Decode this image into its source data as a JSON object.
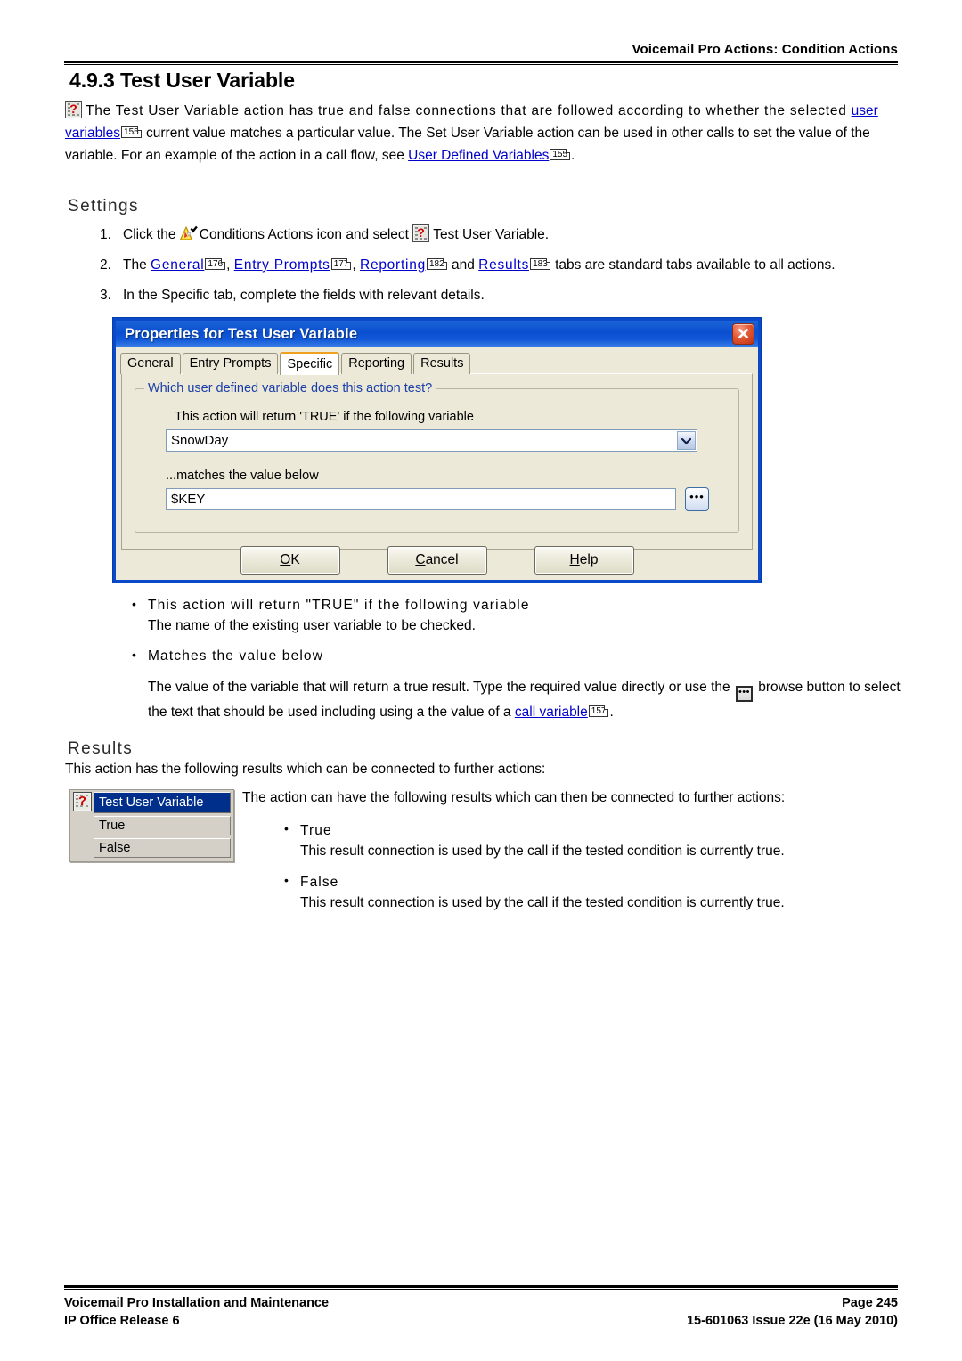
{
  "header": {
    "title": "Voicemail Pro Actions: Condition Actions"
  },
  "section": {
    "heading": "4.9.3 Test User Variable",
    "intro": {
      "part1": "The Test User Variable action has true and false connections that are followed according to whether the selected ",
      "link1": "user variables",
      "ref1": "155",
      "part2": " current value matches a particular value. The Set User Variable action can be used in other calls to set the value of the variable. For an example of the action in a call flow, see ",
      "link2": "User Defined Variables",
      "ref2": "155",
      "part3": "."
    }
  },
  "settings": {
    "heading": "Settings",
    "steps": [
      {
        "num": "1.",
        "pre": "Click the ",
        "mid": "Conditions Actions icon and select ",
        "post": "Test User Variable."
      },
      {
        "num": "2.",
        "pre": "The ",
        "links": [
          {
            "label": "General",
            "ref": "176",
            "sep": ", "
          },
          {
            "label": "Entry Prompts",
            "ref": "177",
            "sep": ", "
          },
          {
            "label": "Reporting",
            "ref": "182",
            "sep": " and "
          },
          {
            "label": "Results",
            "ref": "183",
            "sep": ""
          }
        ],
        "post": " tabs are standard tabs available to all actions."
      },
      {
        "num": "3.",
        "text": "In the Specific tab, complete the fields with relevant details."
      }
    ]
  },
  "dialog": {
    "title": "Properties for Test User Variable",
    "close_icon": "close-icon",
    "tabs": [
      {
        "label": "General",
        "active": false
      },
      {
        "label": "Entry Prompts",
        "active": false
      },
      {
        "label": "Specific",
        "active": true
      },
      {
        "label": "Reporting",
        "active": false
      },
      {
        "label": "Results",
        "active": false
      }
    ],
    "groupbox_label": "Which user defined variable does this action test?",
    "variable_label": "This action will return 'TRUE' if the following variable",
    "variable_value": "SnowDay",
    "matches_label": "...matches the value below",
    "matches_value": "$KEY",
    "browse_dots": "•••",
    "buttons": [
      {
        "accel": "O",
        "rest": "K"
      },
      {
        "accel": "C",
        "rest": "ancel"
      },
      {
        "accel": "H",
        "rest": "elp"
      }
    ],
    "colors": {
      "titlebar": "#0a4fd0",
      "face": "#ece9d8",
      "active_tab_accent": "#f0a020",
      "close": "#e25a34",
      "selection": "#002f8b"
    }
  },
  "field_help": {
    "items": [
      {
        "title": "This action will return \"TRUE\" if the following variable",
        "body_pre": "The name of the existing user variable to be checked.",
        "body_post": "",
        "link": "",
        "ref": ""
      },
      {
        "title": "Matches the value below",
        "body_pre": "The value of the variable that will return a true result. Type the required value directly or use the ",
        "body_mid": " browse button to select the text that should be used including using a the value of a ",
        "link": "call variable",
        "ref": "157",
        "body_post": "."
      }
    ]
  },
  "results": {
    "heading": "Results",
    "intro": "This action has the following results which can be connected to further actions:",
    "node": {
      "icon": "test-user-variable-icon",
      "title": "Test User Variable",
      "rows": [
        "True",
        "False"
      ]
    },
    "body_intro": "The action can have the following results which can then be connected to further actions:",
    "items": [
      {
        "label": "True",
        "text": "This result connection is used by the call if the tested condition is currently true."
      },
      {
        "label": "False",
        "text": "This result connection is used by the call if the tested condition is currently true."
      }
    ]
  },
  "footer": {
    "left_top": "Voicemail Pro Installation and Maintenance",
    "left_bottom": "IP Office Release 6",
    "right_top": "Page 245",
    "right_bottom": "15-601063 Issue 22e (16 May 2010)"
  }
}
